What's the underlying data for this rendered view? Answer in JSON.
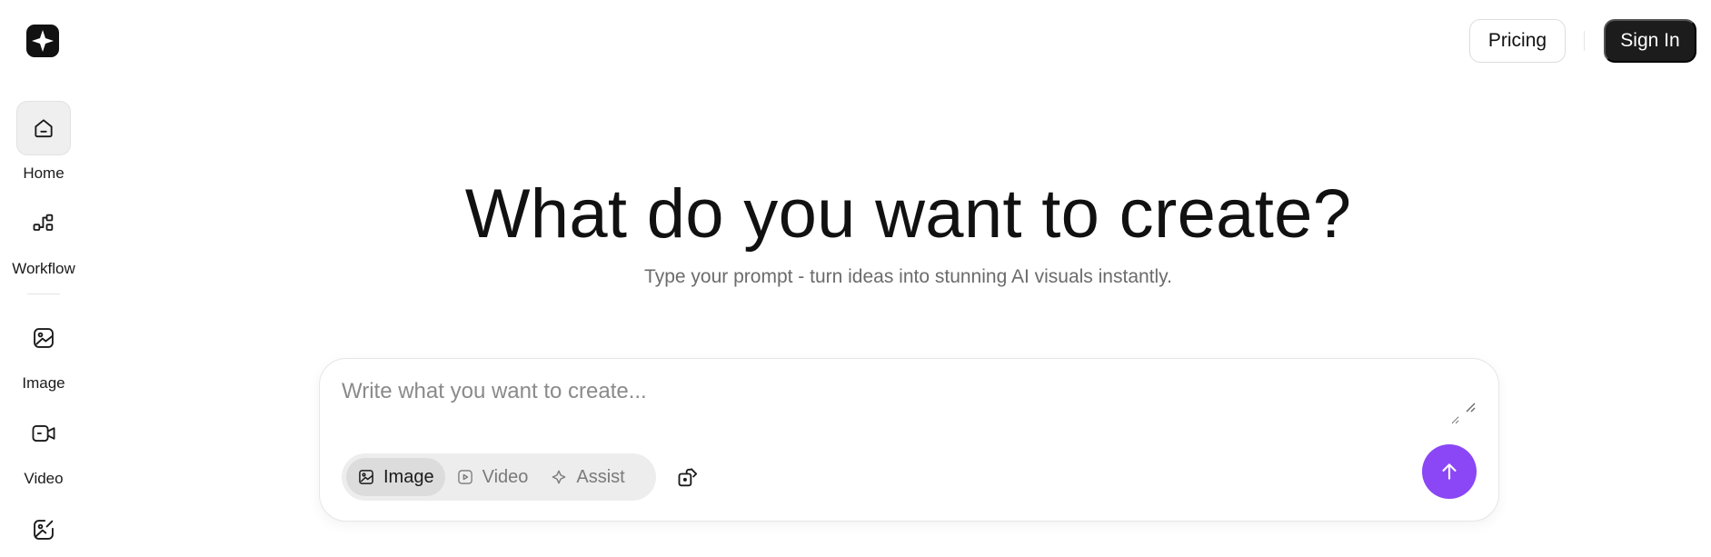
{
  "sidebar": {
    "items": [
      {
        "label": "Home",
        "icon": "home-icon",
        "active": true
      },
      {
        "label": "Workflow",
        "icon": "workflow-icon",
        "active": false
      },
      {
        "label": "Image",
        "icon": "image-icon",
        "active": false
      },
      {
        "label": "Video",
        "icon": "video-icon",
        "active": false
      },
      {
        "label": "",
        "icon": "edit-image-icon",
        "active": false
      }
    ]
  },
  "header": {
    "pricing_label": "Pricing",
    "signin_label": "Sign In"
  },
  "hero": {
    "title": "What do you want to create?",
    "subtitle": "Type your prompt - turn ideas into stunning AI visuals instantly."
  },
  "prompt": {
    "placeholder": "Write what you want to create...",
    "value": "",
    "modes": [
      {
        "label": "Image",
        "icon": "image-icon",
        "active": true
      },
      {
        "label": "Video",
        "icon": "video-icon",
        "active": false
      },
      {
        "label": "Assist",
        "icon": "sparkle-icon",
        "active": false
      }
    ]
  },
  "colors": {
    "accent": "#8b46f5",
    "dark": "#1c1c1c"
  }
}
